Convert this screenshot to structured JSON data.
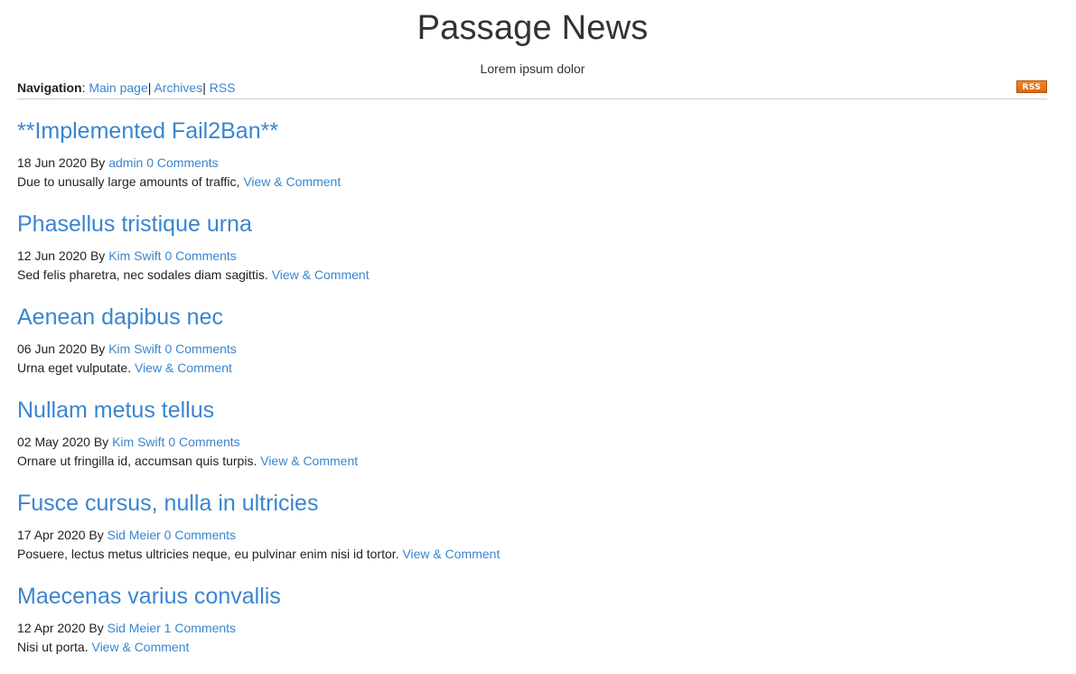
{
  "site": {
    "title": "Passage News",
    "tagline": "Lorem ipsum dolor"
  },
  "nav": {
    "label": "Navigation",
    "colon": ":",
    "separator": "|",
    "items": [
      {
        "label": "Main page"
      },
      {
        "label": "Archives"
      },
      {
        "label": "RSS"
      }
    ],
    "rss_badge": "RSS"
  },
  "colors": {
    "link": "#3a85d0",
    "rss_badge": "#ee7a1a"
  },
  "posts": [
    {
      "title": "**Implemented Fail2Ban**",
      "date": "18 Jun 2020",
      "by": "By",
      "author": "admin",
      "comments": "0 Comments",
      "excerpt": "Due to unusally large amounts of traffic,",
      "view_link": "View & Comment"
    },
    {
      "title": "Phasellus tristique urna",
      "date": "12 Jun 2020",
      "by": "By",
      "author": "Kim Swift",
      "comments": "0 Comments",
      "excerpt": "Sed felis pharetra, nec sodales diam sagittis.",
      "view_link": "View & Comment"
    },
    {
      "title": "Aenean dapibus nec",
      "date": "06 Jun 2020",
      "by": "By",
      "author": "Kim Swift",
      "comments": "0 Comments",
      "excerpt": "Urna eget vulputate.",
      "view_link": "View & Comment"
    },
    {
      "title": "Nullam metus tellus",
      "date": "02 May 2020",
      "by": "By",
      "author": "Kim Swift",
      "comments": "0 Comments",
      "excerpt": "Ornare ut fringilla id, accumsan quis turpis.",
      "view_link": "View & Comment"
    },
    {
      "title": "Fusce cursus, nulla in ultricies",
      "date": "17 Apr 2020",
      "by": "By",
      "author": "Sid Meier",
      "comments": "0 Comments",
      "excerpt": "Posuere, lectus metus ultricies neque, eu pulvinar enim nisi id tortor.",
      "view_link": "View & Comment"
    },
    {
      "title": "Maecenas varius convallis",
      "date": "12 Apr 2020",
      "by": "By",
      "author": "Sid Meier",
      "comments": "1 Comments",
      "excerpt": "Nisi ut porta.",
      "view_link": "View & Comment"
    }
  ]
}
